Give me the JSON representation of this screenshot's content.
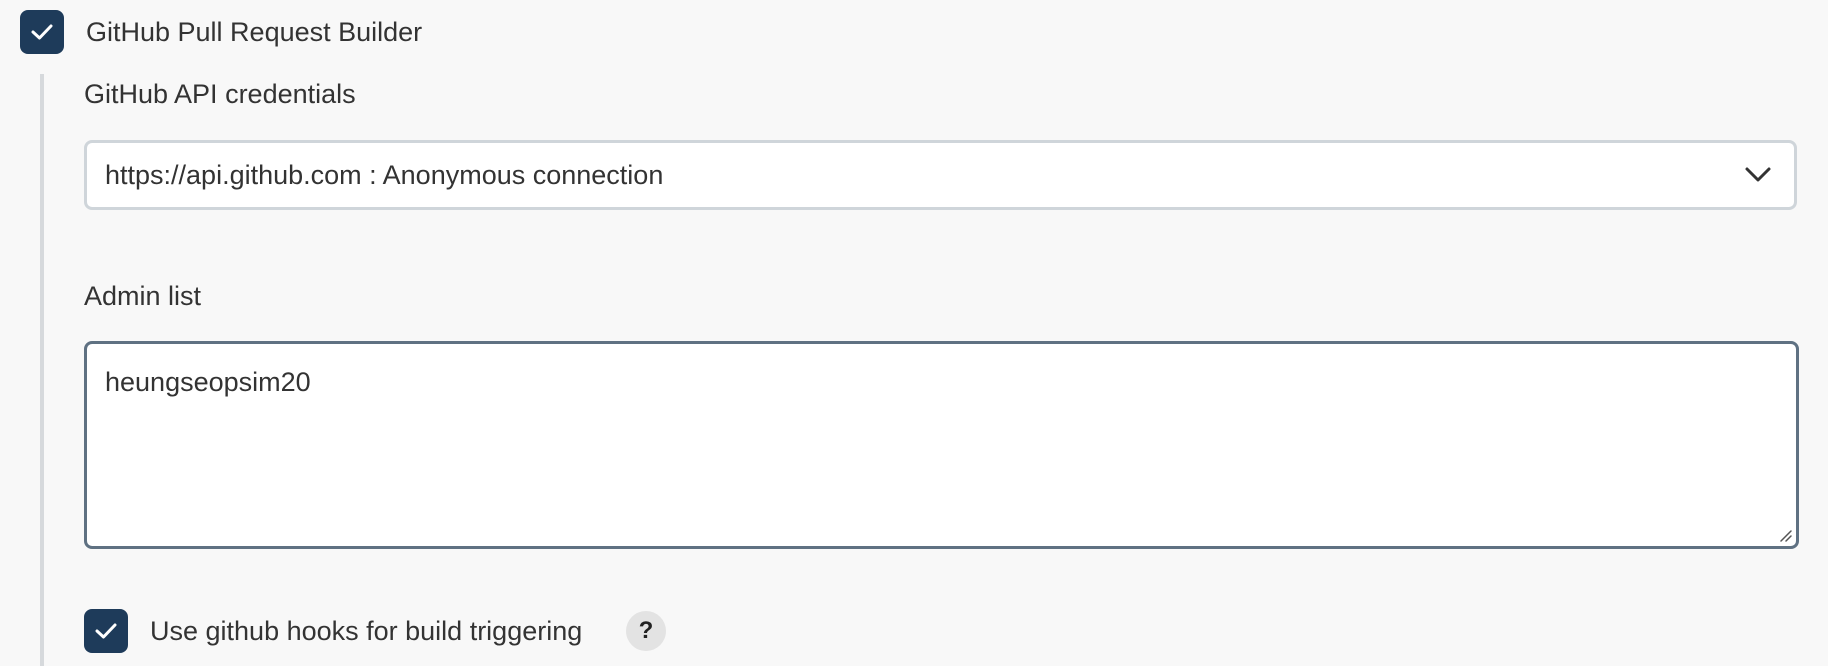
{
  "section": {
    "title": "GitHub Pull Request Builder",
    "enabled": true
  },
  "credentials": {
    "label": "GitHub API credentials",
    "selected": "https://api.github.com : Anonymous connection"
  },
  "admin_list": {
    "label": "Admin list",
    "value": "heungseopsim20"
  },
  "hooks": {
    "label": "Use github hooks for build triggering",
    "checked": true,
    "help": "?"
  },
  "colors": {
    "checkbox": "#1e3b5a",
    "focus_border": "#5f7182",
    "select_border": "#cfd5da",
    "background": "#f8f8f8"
  },
  "icons": {
    "checkbox_check": "check-icon",
    "select": "chevron-down-icon",
    "textarea": "resize-handle-icon"
  }
}
